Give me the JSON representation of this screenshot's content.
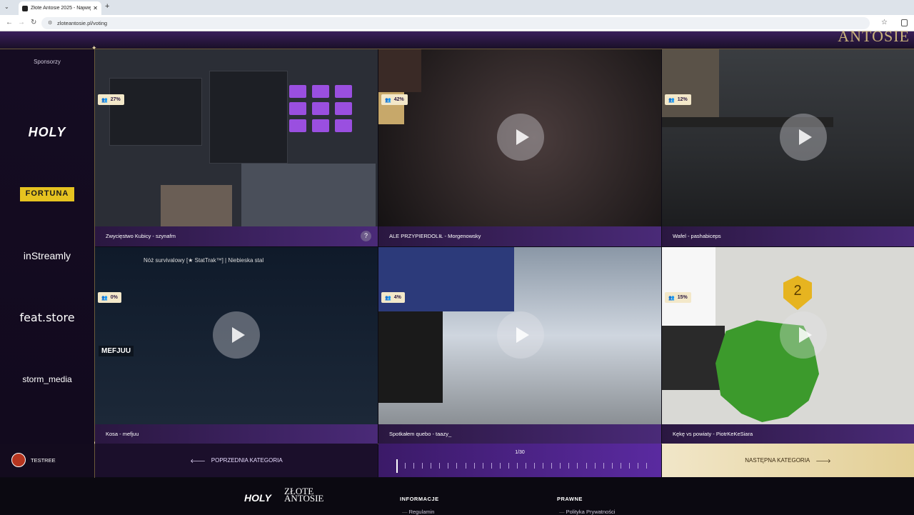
{
  "browser": {
    "tab_title": "Złote Antosie 2025 - Największ",
    "tab_close": "✕",
    "new_tab": "+",
    "url": "zloteantosie.pl/voting"
  },
  "header": {
    "logo_text": "ANTOSIE"
  },
  "sidebar": {
    "label": "Sponsorzy",
    "sponsors": [
      "HOLY",
      "FORTUNA",
      "inStreamly",
      "feat.store",
      "storm_media"
    ]
  },
  "videos": [
    {
      "title": "Zwycięstwo Kubicy - szynafm",
      "percent": "27%"
    },
    {
      "title": "ALE PRZYPIERDOLIŁ - Morgenowsky",
      "percent": "42%"
    },
    {
      "title": "Wafel - pashabiceps",
      "percent": "12%"
    },
    {
      "title": "Kosa - mefjuu",
      "percent": "0%"
    },
    {
      "title": "Spotkałem quebo - taazy_",
      "percent": "4%"
    },
    {
      "title": "Kękę vs powiaty - PiotrKeKeSiara",
      "percent": "15%"
    }
  ],
  "thumb_text": {
    "knife_title": "Nóż survivalowy [★ StatTrak™] | Niebieska stal",
    "mefjuu": "MEFJUU",
    "medal": "2",
    "help": "?"
  },
  "user": {
    "name": "TESTREE"
  },
  "navigation": {
    "prev_label": "POPRZEDNIA KATEGORIA",
    "next_label": "NASTĘPNA KATEGORIA",
    "progress": "1/30",
    "current": 1,
    "total": 30
  },
  "footer": {
    "logo": "HOLY",
    "logo2": "ZŁOTE ANTOSIE",
    "info_heading": "INFORMACJE",
    "info_link": "Regulamin",
    "legal_heading": "PRAWNE",
    "legal_link": "Polityka Prywatności"
  },
  "colors": {
    "accent": "#5a2aa0",
    "gold": "#e3cf95",
    "badge": "#f3e8c9"
  }
}
